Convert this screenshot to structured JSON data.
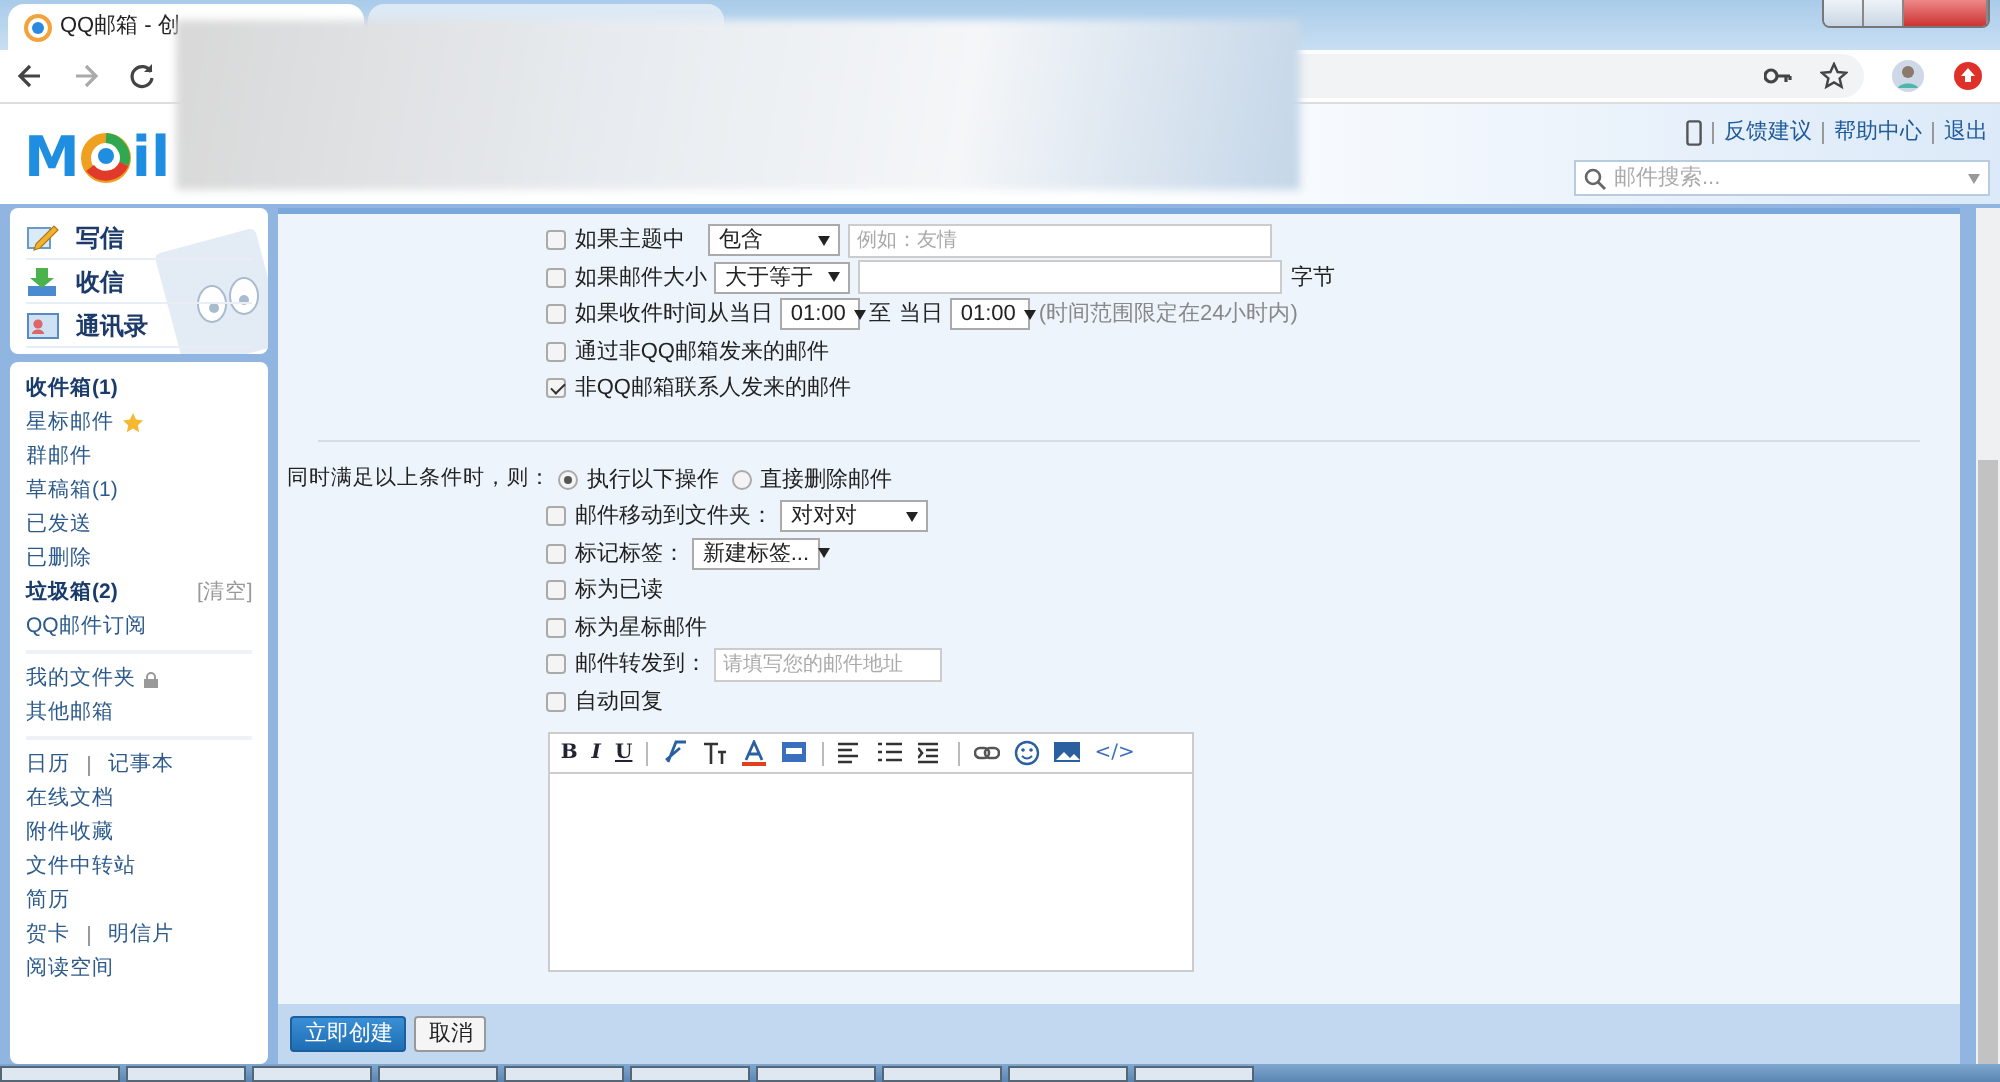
{
  "browser": {
    "tabs": [
      {
        "kind": "titled",
        "title": "QQ邮箱 - 创",
        "selected": true
      },
      {
        "kind": "blurred",
        "selected": false
      }
    ]
  },
  "header": {
    "logo": {
      "left": "M",
      "right": "il"
    },
    "links": [
      "反馈建议",
      "帮助中心",
      "退出"
    ],
    "search": {
      "placeholder": "邮件搜索..."
    }
  },
  "sidebar": {
    "actions": [
      {
        "kind": "write",
        "label": "写信"
      },
      {
        "kind": "receive",
        "label": "收信"
      },
      {
        "kind": "contacts",
        "label": "通讯录"
      }
    ],
    "groups": [
      [
        {
          "labels": [
            "收件箱(1)"
          ],
          "bold": true
        },
        {
          "labels": [
            "星标邮件"
          ],
          "starred": true
        },
        {
          "labels": [
            "群邮件"
          ]
        },
        {
          "labels": [
            "草稿箱(1)"
          ]
        },
        {
          "labels": [
            "已发送"
          ]
        },
        {
          "labels": [
            "已删除"
          ]
        },
        {
          "labels": [
            "垃圾箱(2)"
          ],
          "bold": true,
          "action": "[清空]"
        },
        {
          "labels": [
            "QQ邮件订阅"
          ]
        }
      ],
      [
        {
          "labels": [
            "我的文件夹"
          ],
          "locked": true
        },
        {
          "labels": [
            "其他邮箱"
          ]
        }
      ],
      [
        {
          "labels": [
            "日历",
            "记事本"
          ]
        },
        {
          "labels": [
            "在线文档"
          ]
        },
        {
          "labels": [
            "附件收藏"
          ]
        },
        {
          "labels": [
            "文件中转站"
          ]
        },
        {
          "labels": [
            "简历"
          ]
        },
        {
          "labels": [
            "贺卡",
            "明信片"
          ]
        },
        {
          "labels": [
            "阅读空间"
          ]
        }
      ]
    ]
  },
  "conditions": [
    {
      "checked": false,
      "parts": [
        {
          "kind": "text",
          "text": "如果主题中"
        },
        {
          "kind": "select",
          "value": "包含"
        },
        {
          "kind": "input",
          "placeholder": "例如：友情"
        }
      ]
    },
    {
      "checked": false,
      "parts": [
        {
          "kind": "text",
          "text": "如果邮件大小"
        },
        {
          "kind": "select",
          "value": "大于等于"
        },
        {
          "kind": "input"
        },
        {
          "kind": "text",
          "text": "字节"
        }
      ]
    },
    {
      "checked": false,
      "parts": [
        {
          "kind": "text",
          "text": "如果收件时间从当日"
        },
        {
          "kind": "select",
          "value": "01:00"
        },
        {
          "kind": "text",
          "text": "至"
        },
        {
          "kind": "text",
          "text": "当日"
        },
        {
          "kind": "select",
          "value": "01:00"
        },
        {
          "kind": "note",
          "text": "(时间范围限定在24小时内)"
        }
      ]
    },
    {
      "checked": false,
      "parts": [
        {
          "kind": "text",
          "text": "通过非QQ邮箱发来的邮件"
        }
      ]
    },
    {
      "checked": true,
      "parts": [
        {
          "kind": "text",
          "text": "非QQ邮箱联系人发来的邮件"
        }
      ]
    }
  ],
  "actions": {
    "label": "同时满足以上条件时，则：",
    "radios": [
      {
        "label": "执行以下操作",
        "selected": true
      },
      {
        "label": "直接删除邮件",
        "selected": false
      }
    ],
    "rows": [
      {
        "checked": false,
        "parts": [
          {
            "kind": "text",
            "text": "邮件移动到文件夹："
          },
          {
            "kind": "select",
            "value": "对对对"
          }
        ]
      },
      {
        "checked": false,
        "parts": [
          {
            "kind": "text",
            "text": "标记标签："
          },
          {
            "kind": "select",
            "value": "新建标签..."
          }
        ]
      },
      {
        "checked": false,
        "parts": [
          {
            "kind": "text",
            "text": "标为已读"
          }
        ]
      },
      {
        "checked": false,
        "parts": [
          {
            "kind": "text",
            "text": "标为星标邮件"
          }
        ]
      },
      {
        "checked": false,
        "parts": [
          {
            "kind": "text",
            "text": "邮件转发到："
          },
          {
            "kind": "input",
            "placeholder": "请填写您的邮件地址"
          }
        ]
      },
      {
        "checked": false,
        "parts": [
          {
            "kind": "text",
            "text": "自动回复"
          }
        ]
      }
    ],
    "toolbar": [
      {
        "kind": "text",
        "label": "B"
      },
      {
        "kind": "text",
        "label": "I"
      },
      {
        "kind": "text",
        "label": "U"
      },
      {
        "kind": "sep"
      },
      {
        "kind": "clear-format"
      },
      {
        "kind": "font-size"
      },
      {
        "kind": "font-color"
      },
      {
        "kind": "highlight"
      },
      {
        "kind": "sep"
      },
      {
        "kind": "align"
      },
      {
        "kind": "list"
      },
      {
        "kind": "indent"
      },
      {
        "kind": "sep"
      },
      {
        "kind": "link"
      },
      {
        "kind": "emoji"
      },
      {
        "kind": "image"
      },
      {
        "kind": "text",
        "label": "</>"
      }
    ]
  },
  "footer": {
    "buttons": [
      {
        "kind": "primary",
        "label": "立即创建"
      },
      {
        "kind": "secondary",
        "label": "取消"
      }
    ]
  }
}
